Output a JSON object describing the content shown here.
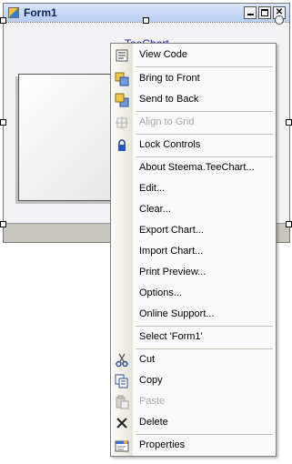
{
  "window": {
    "title": "Form1"
  },
  "chart": {
    "title": "TeeChart"
  },
  "menu": {
    "items": [
      {
        "label": "View Code",
        "icon": "view-code-icon",
        "disabled": false
      },
      {
        "label": "Bring to Front",
        "icon": "bring-to-front-icon",
        "disabled": false
      },
      {
        "label": "Send to Back",
        "icon": "send-to-back-icon",
        "disabled": false
      },
      {
        "label": "Align to Grid",
        "icon": "align-to-grid-icon",
        "disabled": true
      },
      {
        "label": "Lock Controls",
        "icon": "lock-icon",
        "disabled": false
      },
      {
        "label": "About Steema.TeeChart...",
        "icon": "",
        "disabled": false
      },
      {
        "label": "Edit...",
        "icon": "",
        "disabled": false
      },
      {
        "label": "Clear...",
        "icon": "",
        "disabled": false
      },
      {
        "label": "Export Chart...",
        "icon": "",
        "disabled": false
      },
      {
        "label": "Import Chart...",
        "icon": "",
        "disabled": false
      },
      {
        "label": "Print Preview...",
        "icon": "",
        "disabled": false
      },
      {
        "label": "Options...",
        "icon": "",
        "disabled": false
      },
      {
        "label": "Online Support...",
        "icon": "",
        "disabled": false
      },
      {
        "label": "Select 'Form1'",
        "icon": "",
        "disabled": false
      },
      {
        "label": "Cut",
        "icon": "cut-icon",
        "disabled": false
      },
      {
        "label": "Copy",
        "icon": "copy-icon",
        "disabled": false
      },
      {
        "label": "Paste",
        "icon": "paste-icon",
        "disabled": true
      },
      {
        "label": "Delete",
        "icon": "delete-icon",
        "disabled": false
      },
      {
        "label": "Properties",
        "icon": "properties-icon",
        "disabled": false
      }
    ]
  },
  "colors": {
    "menu_bg": "#fafafa",
    "disabled_text": "#a7a6aa",
    "chart_title": "#1a1aa6"
  }
}
